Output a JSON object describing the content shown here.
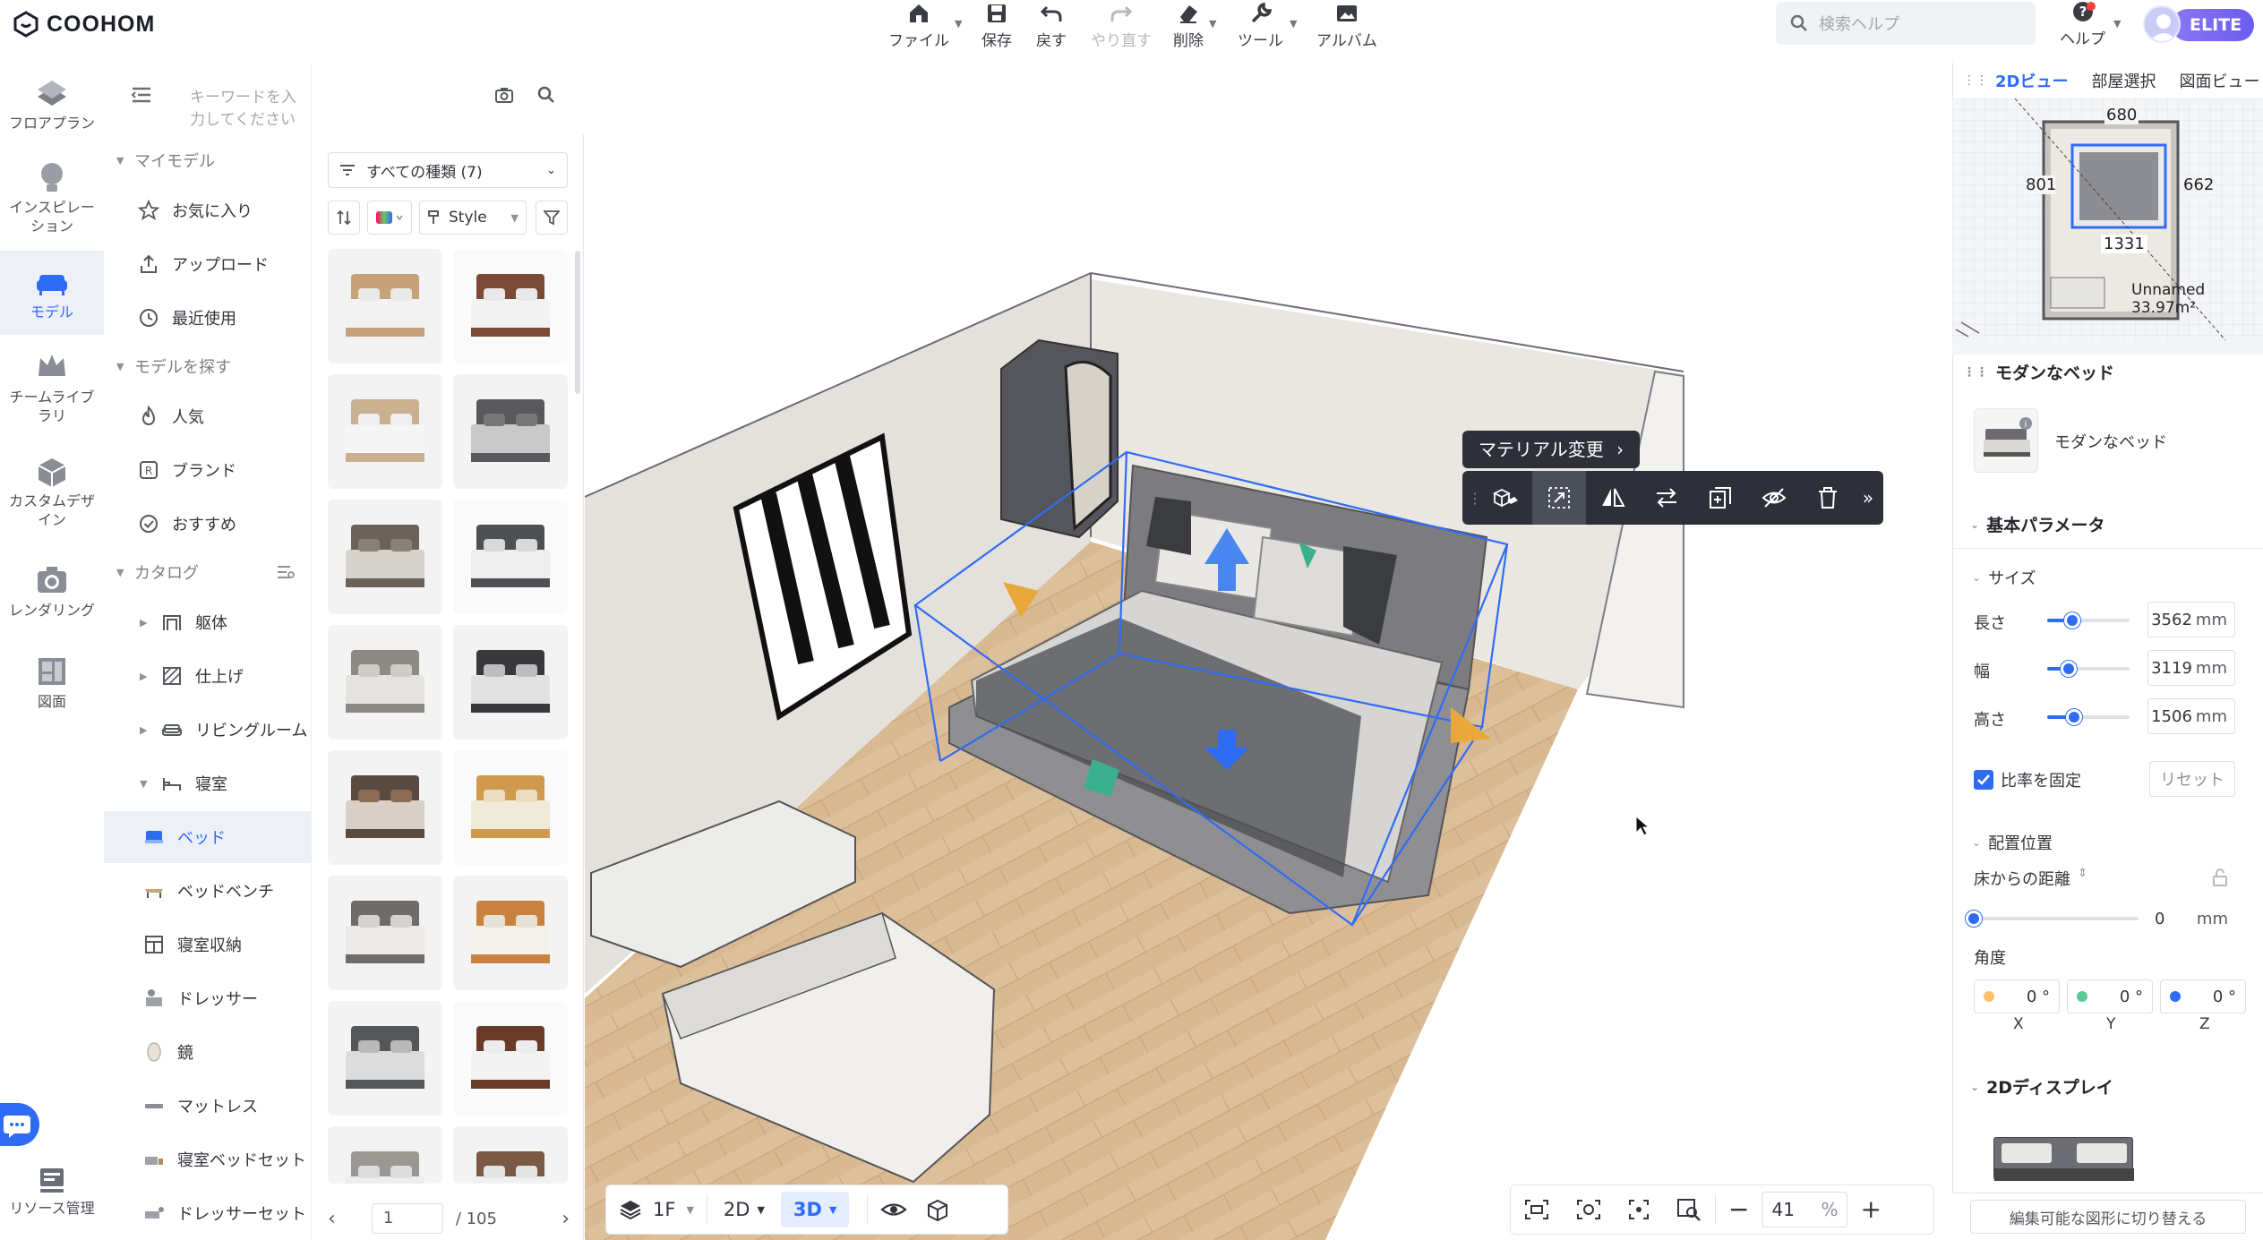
{
  "app": {
    "brand": "COOHOM"
  },
  "toolbar": {
    "file": "ファイル",
    "save": "保存",
    "undo": "戻す",
    "redo": "やり直す",
    "delete": "削除",
    "tools": "ツール",
    "album": "アルバム"
  },
  "header_right": {
    "search_placeholder": "検索ヘルプ",
    "help": "ヘルプ",
    "plan": "ELITE"
  },
  "left_rail": [
    {
      "label": "フロアプラン"
    },
    {
      "label": "インスピレーション"
    },
    {
      "label": "モデル"
    },
    {
      "label": "チームライブラリ"
    },
    {
      "label": "カスタムデザイン"
    },
    {
      "label": "レンダリング"
    },
    {
      "label": "図面"
    },
    {
      "label": "リソース管理"
    }
  ],
  "catalog": {
    "search_placeholder": "キーワードを入力してください",
    "my_models_header": "マイモデル",
    "favorites": "お気に入り",
    "upload": "アップロード",
    "recent": "最近使用",
    "find_header": "モデルを探す",
    "popular": "人気",
    "brand": "ブランド",
    "recommended": "おすすめ",
    "catalog_header": "カタログ",
    "structure": "躯体",
    "finish": "仕上げ",
    "living": "リビングルーム",
    "bedroom": "寝室",
    "bed": "ベッド",
    "bed_bench": "ベッドベンチ",
    "bedroom_storage": "寝室収納",
    "dresser": "ドレッサー",
    "mirror": "鏡",
    "mattress": "マットレス",
    "bedroom_bed_set": "寝室ベッドセット",
    "dresser_set": "ドレッサーセット"
  },
  "model_list": {
    "type_filter": "すべての種類 (7)",
    "style_filter": "Style",
    "page_current": "1",
    "page_total": "/ 105"
  },
  "viewport": {
    "material_change": "マテリアル変更",
    "floor": "1F",
    "mode_2d": "2D",
    "mode_3d": "3D",
    "zoom_value": "41",
    "zoom_unit": "%"
  },
  "right_panel": {
    "tabs": {
      "view_2d": "2Dビュー",
      "room_select": "部屋選択",
      "drawing_view": "図面ビュー"
    },
    "minimap": {
      "dim_top": "680",
      "dim_left": "801",
      "dim_right": "662",
      "dim_center": "1331",
      "room_name": "Unnamed",
      "room_area": "33.97m²"
    },
    "object_title": "モダンなベッド",
    "object_name": "モダンなベッド",
    "basic_params": "基本パラメータ",
    "size_header": "サイズ",
    "length_label": "長さ",
    "length_value": "3562",
    "width_label": "幅",
    "width_value": "3119",
    "height_label": "高さ",
    "height_value": "1506",
    "unit_mm": "mm",
    "lock_ratio": "比率を固定",
    "reset": "リセット",
    "placement_header": "配置位置",
    "floor_distance": "床からの距離",
    "floor_distance_value": "0",
    "angle_label": "角度",
    "angle_x": "0 °",
    "angle_y": "0 °",
    "angle_z": "0 °",
    "axis_x": "X",
    "axis_y": "Y",
    "axis_z": "Z",
    "display_2d": "2Dディスプレイ",
    "switch_editable": "編集可能な図形に切り替える"
  },
  "slider_levels": {
    "length": 0.3,
    "width": 0.26,
    "height": 0.33,
    "floor_distance": 0.0
  },
  "colors": {
    "accent": "#2f6cf5",
    "toolbar_dark": "#2d3039",
    "elite": "#7766f2"
  }
}
